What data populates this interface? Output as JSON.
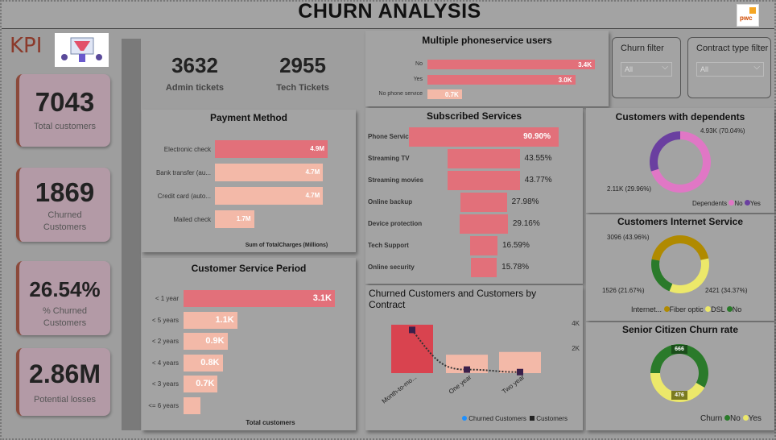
{
  "title": "CHURN ANALYSIS",
  "logo_text": "pwc",
  "kpi_label": "KPI",
  "kpis": [
    {
      "value": "7043",
      "label": "Total customers"
    },
    {
      "value": "1869",
      "label": "Churned Customers"
    },
    {
      "value": "26.54%",
      "label": "% Churned Customers"
    },
    {
      "value": "2.86M",
      "label": "Potential losses"
    }
  ],
  "tickets": {
    "admin_value": "3632",
    "admin_label": "Admin tickets",
    "tech_value": "2955",
    "tech_label": "Tech Tickets"
  },
  "payment": {
    "title": "Payment Method",
    "footer": "Sum of TotalCharges (Millions)",
    "items": [
      {
        "label": "Electronic check",
        "value": 4.9,
        "text": "4.9M",
        "color": "#e2707a"
      },
      {
        "label": "Bank transfer (au...",
        "value": 4.7,
        "text": "4.7M",
        "color": "#f3b9a8"
      },
      {
        "label": "Credit card (auto...",
        "value": 4.7,
        "text": "4.7M",
        "color": "#f3b9a8"
      },
      {
        "label": "Mailed check",
        "value": 1.7,
        "text": "1.7M",
        "color": "#f3b9a8"
      }
    ]
  },
  "service_period": {
    "title": "Customer Service Period",
    "footer": "Total customers",
    "items": [
      {
        "label": "< 1 year",
        "value": 3.1,
        "text": "3.1K",
        "color": "#e2707a"
      },
      {
        "label": "< 5 years",
        "value": 1.1,
        "text": "1.1K",
        "color": "#f3b9a8"
      },
      {
        "label": "< 2 years",
        "value": 0.9,
        "text": "0.9K",
        "color": "#f3b9a8"
      },
      {
        "label": "< 4 years",
        "value": 0.8,
        "text": "0.8K",
        "color": "#f3b9a8"
      },
      {
        "label": "< 3 years",
        "value": 0.7,
        "text": "0.7K",
        "color": "#f3b9a8"
      },
      {
        "label": "<= 6 years",
        "value": 0.35,
        "text": "",
        "color": "#f3b9a8"
      }
    ]
  },
  "phone": {
    "title": "Multiple phoneservice users",
    "items": [
      {
        "label": "No",
        "value": 3.4,
        "text": "3.4K",
        "color": "#e2707a"
      },
      {
        "label": "Yes",
        "value": 3.0,
        "text": "3.0K",
        "color": "#e2707a"
      },
      {
        "label": "No phone service",
        "value": 0.7,
        "text": "0.7K",
        "color": "#f3b9a8"
      }
    ]
  },
  "subscribed": {
    "title": "Subscribed Services",
    "items": [
      {
        "label": "Phone Service",
        "value": 90.9,
        "text": "90.90%"
      },
      {
        "label": "Streaming TV",
        "value": 43.55,
        "text": "43.55%"
      },
      {
        "label": "Streaming movies",
        "value": 43.77,
        "text": "43.77%"
      },
      {
        "label": "Online backup",
        "value": 27.98,
        "text": "27.98%"
      },
      {
        "label": "Device protection",
        "value": 29.16,
        "text": "29.16%"
      },
      {
        "label": "Tech Support",
        "value": 16.59,
        "text": "16.59%"
      },
      {
        "label": "Online security",
        "value": 15.78,
        "text": "15.78%"
      }
    ]
  },
  "contract": {
    "title": "Churned Customers and Customers by Contract",
    "categories": [
      "Month-to-mo...",
      "One year",
      "Two year"
    ],
    "churned": [
      1655,
      166,
      48
    ],
    "customers": [
      3875,
      1473,
      1695
    ],
    "yticks": [
      "4K",
      "2K"
    ],
    "legend_churned": "Churned Customers",
    "legend_customers": "Customers"
  },
  "filters": [
    {
      "label": "Churn filter",
      "value": "All"
    },
    {
      "label": "Contract type filter",
      "value": "All"
    }
  ],
  "dependents": {
    "title": "Customers with dependents",
    "no_text": "4.93K (70.04%)",
    "yes_text": "2.11K (29.96%)",
    "no": 70.04,
    "yes": 29.96,
    "legend_title": "Dependents",
    "legend_no": "No",
    "legend_yes": "Yes",
    "color_no": "#e077c5",
    "color_yes": "#6a3fa0"
  },
  "internet": {
    "title": "Customers Internet Service",
    "fiber_text": "3096 (43.96%)",
    "dsl_text": "2421 (34.37%)",
    "no_text": "1526 (21.67%)",
    "fiber": 43.96,
    "dsl": 34.37,
    "no": 21.67,
    "legend_title": "Internet...",
    "legend_fiber": "Fiber optic",
    "legend_dsl": "DSL",
    "legend_no": "No",
    "color_fiber": "#b08a00",
    "color_dsl": "#ece86a",
    "color_no": "#2a7a2a"
  },
  "senior": {
    "title": "Senior Citizen Churn rate",
    "no_text": "666",
    "yes_text": "476",
    "no": 666,
    "yes": 476,
    "legend_title": "Churn",
    "legend_no": "No",
    "legend_yes": "Yes",
    "color_no": "#2a7a2a",
    "color_yes": "#ece86a"
  },
  "colors": {
    "accent": "#e2707a",
    "light": "#f3b9a8",
    "panel": "#a3a3a3",
    "bg": "#9e9e9e",
    "kpi": "#b39aa6"
  }
}
